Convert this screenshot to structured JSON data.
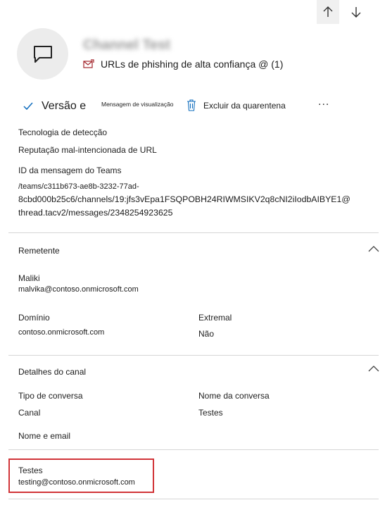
{
  "nav": {
    "up_icon": "arrow-up-icon",
    "down_icon": "arrow-down-icon"
  },
  "header": {
    "avatar_icon": "chat-message-icon",
    "title": "Channel Test",
    "threat_icon": "phishing-mail-icon",
    "threat_label": "URLs de phishing de alta confiança @ (1)"
  },
  "toolbar": {
    "check_icon": "checkmark-icon",
    "version_label": "Versão e",
    "preview_label": "Mensagem de visualização",
    "trash_icon": "trash-icon",
    "release_label": "Excluir da quarentena",
    "more_icon": "more-ellipsis-icon",
    "more_label": "..."
  },
  "details": {
    "detection_tech_label": "Tecnologia de detecção",
    "detection_tech_value": "Reputação mal-intencionada de URL",
    "teams_id_label": "ID da mensagem do Teams",
    "teams_id_line1": "/teams/c311b673-ae8b-3232-77ad-",
    "teams_id_line2": "8cbd000b25c6/channels/19:jfs3vEpa1FSQPOBH24RIWMSIKV2q8cNI2iIodbAIBYE1@",
    "teams_id_line3": "thread.tacv2/messages/2348254923625"
  },
  "sender": {
    "heading": "Remetente",
    "name": "Maliki",
    "email": "malvika@contoso.onmicrosoft.com",
    "domain_label": "Domínio",
    "domain_value": "contoso.onmicrosoft.com",
    "external_label": "Extremal",
    "external_value": "Não"
  },
  "channel": {
    "heading": "Detalhes do canal",
    "conv_type_label": "Tipo de conversa",
    "conv_type_value": "Canal",
    "conv_name_label": "Nome da conversa",
    "conv_name_value": "Testes",
    "name_email_label": "Nome e email"
  },
  "highlighted": {
    "name": "Testes",
    "email": "testing@contoso.onmicrosoft.com"
  },
  "colors": {
    "highlight_border": "#d13438",
    "accent": "#0f6cbd",
    "threat_icon": "#a4262c"
  }
}
